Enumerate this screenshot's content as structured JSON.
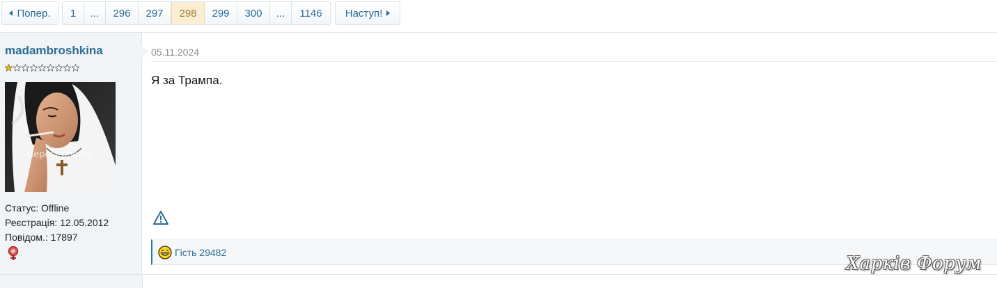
{
  "pagination": {
    "prev_label": "Попер.",
    "next_label": "Наступ!",
    "pages": [
      "1",
      "...",
      "296",
      "297",
      "298",
      "299",
      "300",
      "...",
      "1146"
    ],
    "current": "298"
  },
  "post": {
    "author": {
      "username": "madambroshkina",
      "rank_stars_filled": 1,
      "rank_stars_total": 9,
      "avatar_caption": "depositphotos",
      "status": "Статус: Offline",
      "registered": "Реєстрація: 12.05.2012",
      "posts": "Повідом.: 17897",
      "gender_icon": "female-gender-icon"
    },
    "date": "05.11.2024",
    "message": "Я за Трампа.",
    "report_icon": "warning-triangle-icon",
    "likes": {
      "icon": "laughing-smiley-icon",
      "names": "Гість 29482"
    }
  },
  "watermark": "Харків Форум",
  "colors": {
    "link": "#2b6c93",
    "current_page_bg": "#fbeed5",
    "sidebar_bg": "#f1f4f7",
    "likes_accent": "#2b7bb3"
  }
}
